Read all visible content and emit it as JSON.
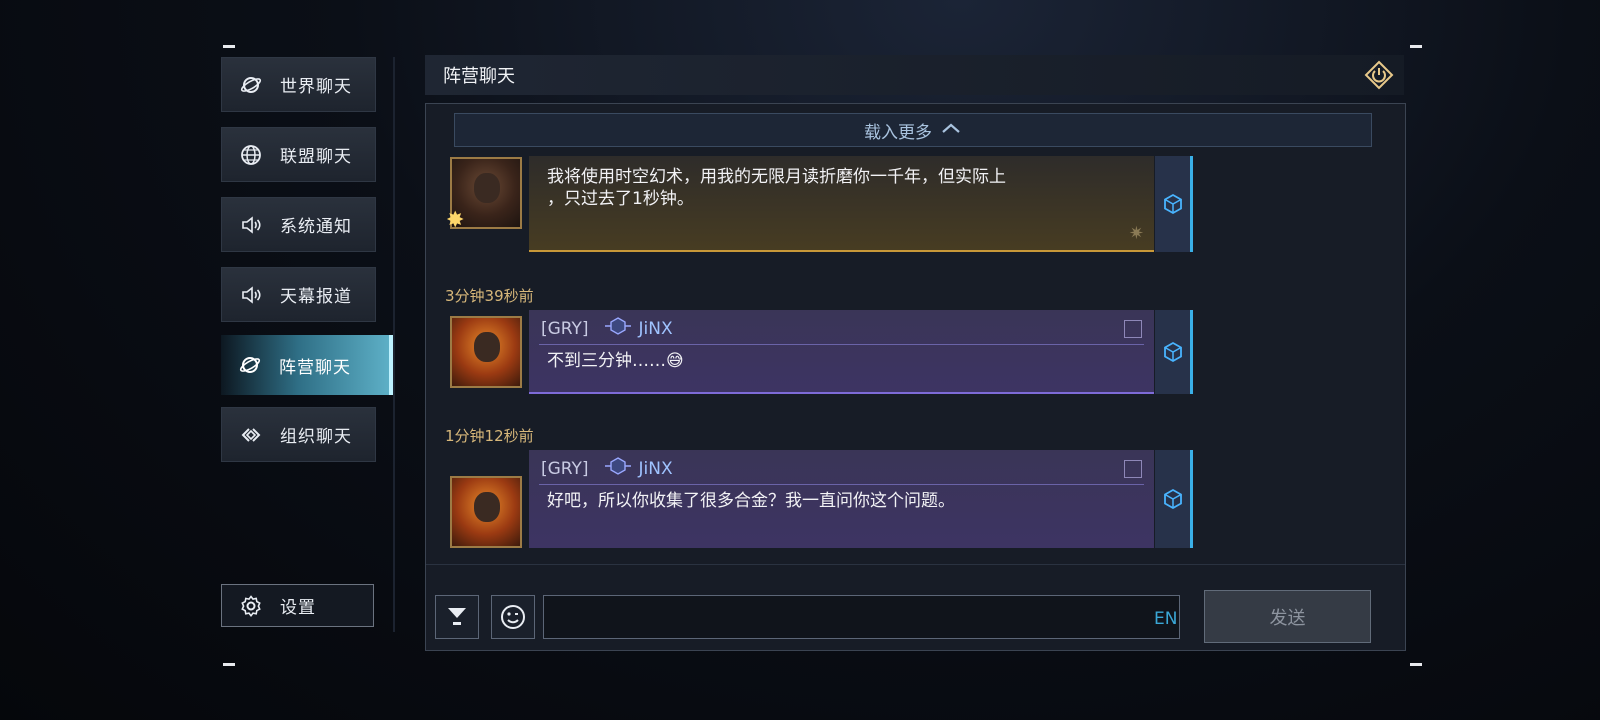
{
  "sidebar": {
    "items": [
      {
        "label": "世界聊天",
        "icon": "planet-icon"
      },
      {
        "label": "联盟聊天",
        "icon": "globe-icon"
      },
      {
        "label": "系统通知",
        "icon": "speaker-icon"
      },
      {
        "label": "天幕报道",
        "icon": "speaker-icon"
      },
      {
        "label": "阵营聊天",
        "icon": "planet-icon",
        "active": true
      },
      {
        "label": "组织聊天",
        "icon": "link-icon"
      }
    ],
    "settings_label": "设置"
  },
  "header": {
    "title": "阵营聊天"
  },
  "chat": {
    "load_more": "载入更多",
    "messages": [
      {
        "text": "我将使用时空幻术，用我的无限月读折磨你一千年，但实际上，只过去了1秒钟。",
        "line1": "我将使用时空幻术，用我的无限月读折磨你一千年，但实际上",
        "line2": "，只过去了1秒钟。",
        "style": "gold"
      },
      {
        "time": "3分钟39秒前",
        "tag": "[GRY]",
        "name": "JiNX",
        "text": "不到三分钟……😅",
        "style": "purple"
      },
      {
        "time": "1分钟12秒前",
        "tag": "[GRY]",
        "name": "JiNX",
        "text": "好吧，所以你收集了很多合金？我一直问你这个问题。",
        "style": "purple"
      }
    ]
  },
  "composer": {
    "input_value": "",
    "lang": "EN",
    "send_label": "发送"
  },
  "colors": {
    "accent": "#3ab0e8",
    "gold": "#c89838",
    "purple": "#7e6bd8"
  }
}
